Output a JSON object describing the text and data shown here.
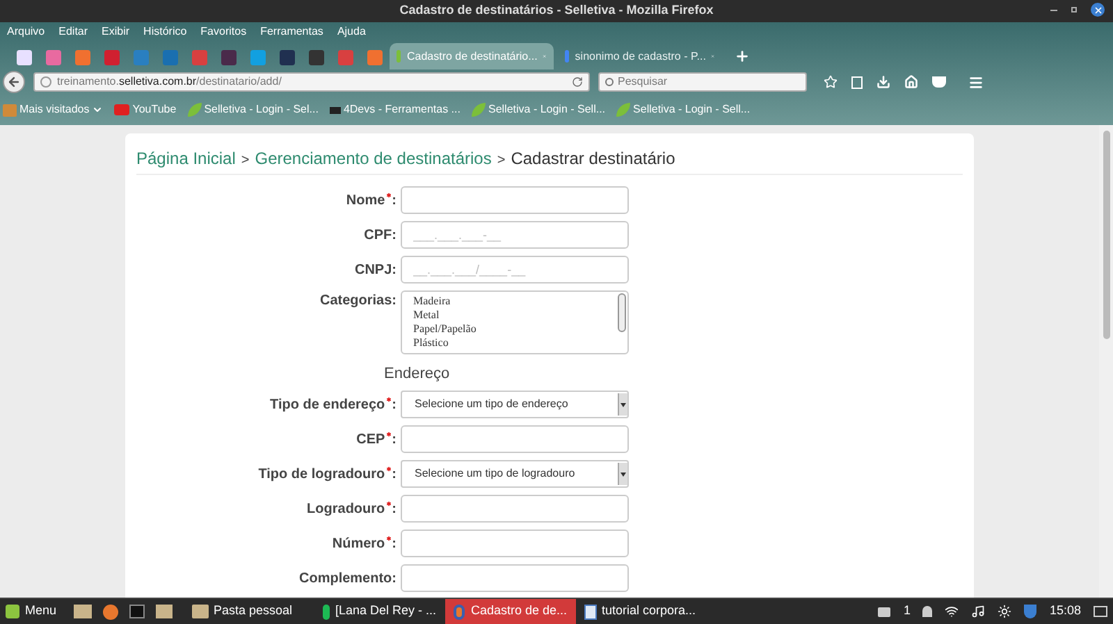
{
  "window": {
    "title": "Cadastro de destinatários - Selletiva - Mozilla Firefox"
  },
  "menu": [
    "Arquivo",
    "Editar",
    "Exibir",
    "Histórico",
    "Favoritos",
    "Ferramentas",
    "Ajuda"
  ],
  "tabs": [
    {
      "label": "Cadastro de destinatário...",
      "selected": true
    },
    {
      "label": "sinonimo de cadastro - P...",
      "selected": false
    }
  ],
  "url": {
    "prefix": "treinamento.",
    "domain": "selletiva.com.br",
    "path": "/destinatario/add/"
  },
  "search": {
    "placeholder": "Pesquisar"
  },
  "bookmarks": [
    {
      "label": "Mais visitados",
      "kind": "folder"
    },
    {
      "label": "YouTube",
      "kind": "video"
    },
    {
      "label": "Selletiva - Login - Sel...",
      "kind": "leaf"
    },
    {
      "label": "4Devs - Ferramentas ...",
      "kind": "dev"
    },
    {
      "label": "Selletiva - Login - Sell...",
      "kind": "leaf"
    },
    {
      "label": "Selletiva - Login - Sell...",
      "kind": "leaf"
    }
  ],
  "breadcrumb": [
    {
      "kind": "link",
      "text": "Página Inicial"
    },
    {
      "kind": "separator",
      "text": ">"
    },
    {
      "kind": "link",
      "text": "Gerenciamento de destinatários"
    },
    {
      "kind": "separator",
      "text": ">"
    },
    {
      "kind": "current",
      "text": "Cadastrar destinatário"
    }
  ],
  "fields": [
    {
      "kind": "text",
      "label": "Nome",
      "required": true,
      "colon": ":"
    },
    {
      "kind": "text",
      "label": "CPF",
      "required": false,
      "colon": ":",
      "placeholder": "___.___.___-__"
    },
    {
      "kind": "text",
      "label": "CNPJ",
      "required": false,
      "colon": ":",
      "placeholder": "__.___.___/____-__"
    },
    {
      "kind": "listbox",
      "label": "Categorias",
      "required": false,
      "colon": ":",
      "options": [
        "Madeira",
        "Metal",
        "Papel/Papelão",
        "Plástico"
      ]
    },
    {
      "kind": "section",
      "label": "Endereço"
    },
    {
      "kind": "select",
      "label": "Tipo de endereço",
      "required": true,
      "colon": ":",
      "placeholder": "Selecione um tipo de endereço"
    },
    {
      "kind": "text",
      "label": "CEP",
      "required": true,
      "colon": ":"
    },
    {
      "kind": "select",
      "label": "Tipo de logradouro",
      "required": true,
      "colon": ":",
      "placeholder": "Selecione um tipo de logradouro"
    },
    {
      "kind": "text",
      "label": "Logradouro",
      "required": true,
      "colon": ":"
    },
    {
      "kind": "text",
      "label": "Número",
      "required": true,
      "colon": ":"
    },
    {
      "kind": "text",
      "label": "Complemento",
      "required": false,
      "colon": ":"
    }
  ],
  "taskbar": {
    "menu": "Menu",
    "windows": [
      {
        "label": "Pasta pessoal",
        "kind": "folder",
        "selected": false
      },
      {
        "label": "[Lana Del Rey - ...",
        "kind": "music",
        "selected": false
      },
      {
        "label": "Cadastro de de...",
        "kind": "browser",
        "selected": true
      },
      {
        "label": "tutorial corpora...",
        "kind": "doc",
        "selected": false
      }
    ],
    "notifications": "1",
    "clock": "15:08"
  }
}
